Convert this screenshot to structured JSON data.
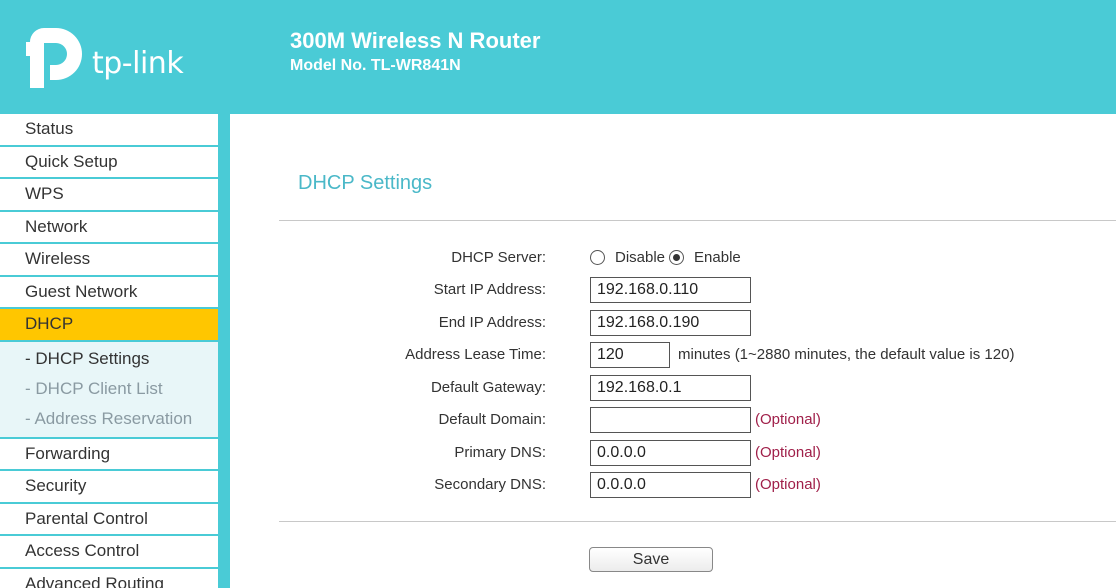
{
  "header": {
    "logo_text": "tp-link",
    "title": "300M Wireless N Router",
    "model": "Model No. TL-WR841N",
    "brand_color": "#4acbd6"
  },
  "sidebar": {
    "items": [
      {
        "label": "Status"
      },
      {
        "label": "Quick Setup"
      },
      {
        "label": "WPS"
      },
      {
        "label": "Network"
      },
      {
        "label": "Wireless"
      },
      {
        "label": "Guest Network"
      },
      {
        "label": "DHCP",
        "active": true
      },
      {
        "label": "Forwarding"
      },
      {
        "label": "Security"
      },
      {
        "label": "Parental Control"
      },
      {
        "label": "Access Control"
      },
      {
        "label": "Advanced Routing"
      }
    ],
    "dhcp_submenu": [
      {
        "label": "- DHCP Settings"
      },
      {
        "label": "- DHCP Client List"
      },
      {
        "label": "- Address Reservation"
      }
    ],
    "active_color": "#ffc600"
  },
  "main": {
    "title": "DHCP Settings",
    "dhcp_server": {
      "label": "DHCP Server:",
      "disable_label": "Disable",
      "enable_label": "Enable",
      "selected": "Enable"
    },
    "start_ip": {
      "label": "Start IP Address:",
      "value": "192.168.0.110"
    },
    "end_ip": {
      "label": "End IP Address:",
      "value": "192.168.0.190"
    },
    "lease_time": {
      "label": "Address Lease Time:",
      "value": "120",
      "hint": "minutes (1~2880 minutes, the default value is 120)"
    },
    "gateway": {
      "label": "Default Gateway:",
      "value": "192.168.0.1"
    },
    "domain": {
      "label": "Default Domain:",
      "value": "",
      "note": "(Optional)"
    },
    "primary_dns": {
      "label": "Primary DNS:",
      "value": "0.0.0.0",
      "note": "(Optional)"
    },
    "secondary_dns": {
      "label": "Secondary DNS:",
      "value": "0.0.0.0",
      "note": "(Optional)"
    },
    "save_label": "Save"
  }
}
